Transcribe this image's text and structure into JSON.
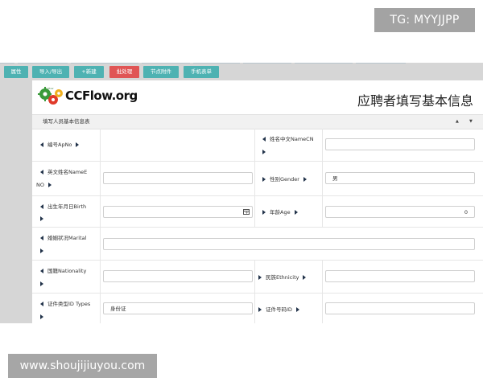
{
  "watermark_top": "TG: MYYJJPP",
  "watermark_bottom": "www.shoujijiuyou.com",
  "toolbar": [
    {
      "label": "属性",
      "color": "#4eb2b2"
    },
    {
      "label": "导入/导出",
      "color": "#4eb2b2"
    },
    {
      "label": "+新建",
      "color": "#4eb2b2"
    },
    {
      "label": "批处理",
      "color": "#e05555"
    },
    {
      "label": "节点附件",
      "color": "#4eb2b2"
    },
    {
      "label": "手机表单",
      "color": "#4eb2b2"
    }
  ],
  "logo": {
    "text": "CCFlow.org",
    "small_text": "ccflow"
  },
  "form": {
    "title": "应聘者填写基本信息",
    "section_title": "填写人员基本信息表",
    "fields": {
      "ap_no": {
        "label": "编号ApNo",
        "value": ""
      },
      "name_cn": {
        "label": "姓名中文NameCN",
        "value": ""
      },
      "name_en": {
        "label_1": "英文姓名NameE",
        "label_2": "NO",
        "value": ""
      },
      "gender": {
        "label": "性别Gender",
        "value": "男"
      },
      "birth": {
        "label": "出生年月日Birth",
        "value": ""
      },
      "age": {
        "label": "年龄Age",
        "value": "0"
      },
      "marital": {
        "label": "婚姻状况Marital",
        "value": ""
      },
      "nationality": {
        "label": "国籍Nationality",
        "value": ""
      },
      "ethnicity": {
        "label": "民族Ethnicity",
        "value": ""
      },
      "id_types": {
        "label": "证件类型ID Types",
        "value": "身份证"
      },
      "id_no": {
        "label": "证件号码ID",
        "value": ""
      }
    }
  }
}
